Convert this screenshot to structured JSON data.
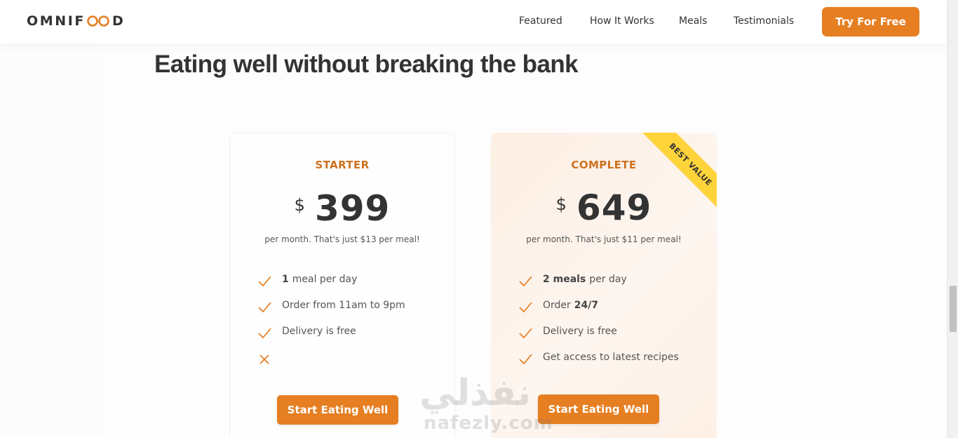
{
  "brand": {
    "logo_left": "OMNIF",
    "logo_right": "D",
    "accent": "#e67e22"
  },
  "nav": {
    "items": [
      "Featured",
      "How It Works",
      "Meals",
      "Testimonials"
    ],
    "cta": "Try For Free"
  },
  "section": {
    "heading": "Eating well without breaking the bank"
  },
  "plans": [
    {
      "name": "STARTER",
      "currency": "$",
      "price": "399",
      "per": "per month. That's just $13 per meal!",
      "features": [
        {
          "icon": "check-icon",
          "bold": "1",
          "text": "meal per day"
        },
        {
          "icon": "check-icon",
          "text": "Order from 11am to 9pm"
        },
        {
          "icon": "check-icon",
          "text": "Delivery is free"
        },
        {
          "icon": "close-icon",
          "text": ""
        }
      ],
      "button": "Start Eating Well"
    },
    {
      "name": "COMPLETE",
      "currency": "$",
      "price": "649",
      "per": "per month. That's just $11 per meal!",
      "badge": "BEST VALUE",
      "features": [
        {
          "icon": "check-icon",
          "bold": "2 meals",
          "text": "per day"
        },
        {
          "icon": "check-icon",
          "text": "Order",
          "bold_after": "24/7"
        },
        {
          "icon": "check-icon",
          "text": "Delivery is free"
        },
        {
          "icon": "check-icon",
          "text": "Get access to latest recipes"
        }
      ],
      "button": "Start Eating Well"
    }
  ],
  "watermark": {
    "arabic": "نفذلي",
    "latin": "nafezly.com"
  }
}
